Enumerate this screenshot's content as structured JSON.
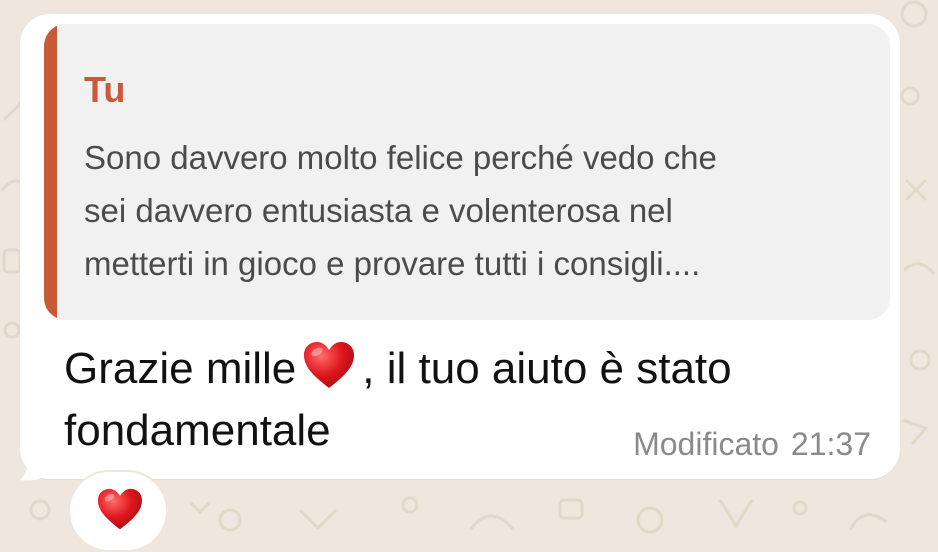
{
  "colors": {
    "wallpaper": "#efe7dd",
    "bubble": "#ffffff",
    "quote_background": "#f1f1f2",
    "quote_accent": "#c85a38",
    "message_text": "#111111",
    "meta_text": "#8a8a8a",
    "heart": "#e0161e"
  },
  "quoted_message": {
    "author": "Tu",
    "lines": [
      "Sono davvero molto felice perché vedo che",
      "sei davvero entusiasta e volenterosa nel",
      "metterti in gioco e provare tutti i consigli...."
    ]
  },
  "message": {
    "line1_before_emoji": "Grazie mille",
    "emoji": "red-heart-icon",
    "line1_after_emoji": ", il tuo aiuto è stato",
    "line2": "fondamentale",
    "edited_label": "Modificato",
    "time": "21:37"
  },
  "reaction": {
    "emoji": "red-heart-icon"
  }
}
